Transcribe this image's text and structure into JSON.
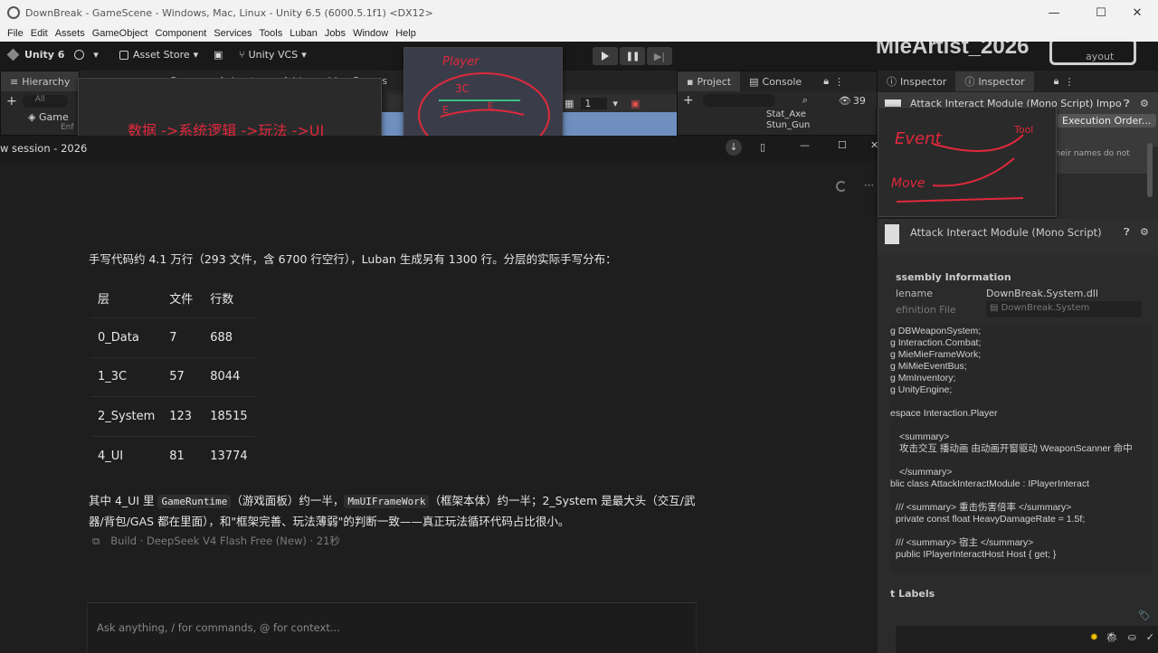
{
  "window": {
    "title": "DownBreak - GameScene - Windows, Mac, Linux - Unity 6.5 (6000.5.1f1) <DX12>",
    "min": "—",
    "max": "☐",
    "close": "✕"
  },
  "menu": [
    "File",
    "Edit",
    "Assets",
    "GameObject",
    "Component",
    "Services",
    "Tools",
    "Luban",
    "Jobs",
    "Window",
    "Help"
  ],
  "toolbar": {
    "unity": "Unity 6",
    "account": " ▾",
    "asset_store": "Asset Store",
    "vcs": "Unity VCS",
    "watermark": "MieArtist_2026",
    "layout_hint": "ayout"
  },
  "hierarchy": {
    "tab": "Hierarchy",
    "search": "All",
    "root": "Game",
    "child": "Enf"
  },
  "project": {
    "tabs": [
      "Project",
      "Console"
    ],
    "items": [
      "Stat_Axe",
      "Stun_Gun"
    ],
    "count": "39"
  },
  "scene_tabs": [
    "Scene",
    "Animator",
    "Addressables Groups"
  ],
  "scene_toolbar": {
    "value": "1"
  },
  "overlay_left": {
    "text": "数据 ->系统逻辑 ->玩法 ->UI"
  },
  "overlay_sketch": {
    "title": "Player",
    "mid": "3C",
    "l": "E",
    "r": "E"
  },
  "overlay_right": {
    "a": "Event",
    "b": "Tool",
    "c": "Move"
  },
  "chat": {
    "session": "w session - 2026",
    "intro": "手写代码约 4.1 万行（293 文件，含 6700 行空行），Luban 生成另有 1300 行。分层的实际手写分布：",
    "table": {
      "headers": [
        "层",
        "文件",
        "行数"
      ],
      "rows": [
        [
          "0_Data",
          "7",
          "688"
        ],
        [
          "1_3C",
          "57",
          "8044"
        ],
        [
          "2_System",
          "123",
          "18515"
        ],
        [
          "4_UI",
          "81",
          "13774"
        ]
      ]
    },
    "summary": {
      "p1": "其中 4_UI 里 ",
      "code1": "GameRuntime",
      "p2": "（游戏面板）约一半，",
      "code2": "MmUIFrameWork",
      "p3": "（框架本体）约一半；2_System 是最大头（交互/武",
      "line2": "器/背包/GAS 都在里面），和\"框架完善、玩法薄弱\"的判断一致——真正玩法循环代码占比很小。"
    },
    "meta": "Build · DeepSeek V4 Flash Free (New) · 21秒",
    "input_placeholder": "Ask anything, / for commands, @ for context..."
  },
  "inspector": {
    "tabs": [
      "Inspector",
      "Inspector"
    ],
    "header1": "Attack Interact Module (Mono Script) Impo",
    "exec_button": "Execution Order...",
    "warn": "their names do not",
    "header2": "Attack Interact Module (Mono Script)",
    "assembly_title": "ssembly Information",
    "filename_label": "lename",
    "filename_value": "DownBreak.System.dll",
    "def_label": "efinition File",
    "def_value": "DownBreak.System",
    "code": [
      "g DBWeaponSystem;",
      "g Interaction.Combat;",
      "g MieMieFrameWork;",
      "g MiMieEventBus;",
      "g MmInventory;",
      "g UnityEngine;",
      "",
      "espace Interaction.Player",
      "",
      "<summary>",
      "攻击交互 播动画 由动画开窗驱动 WeaponScanner 命中",
      "",
      "</summary>",
      "blic class AttackInteractModule : IPlayerInteract",
      "",
      "/// <summary> 重击伤害倍率 </summary>",
      "private const float HeavyDamageRate = 1.5f;",
      "",
      "/// <summary> 宿主 </summary>",
      "public IPlayerInteractHost Host { get; }"
    ],
    "labels_title": "t Labels"
  },
  "colors": {
    "accent_red": "#e0283c",
    "bg": "#1e1e1e",
    "panel": "#282828"
  }
}
